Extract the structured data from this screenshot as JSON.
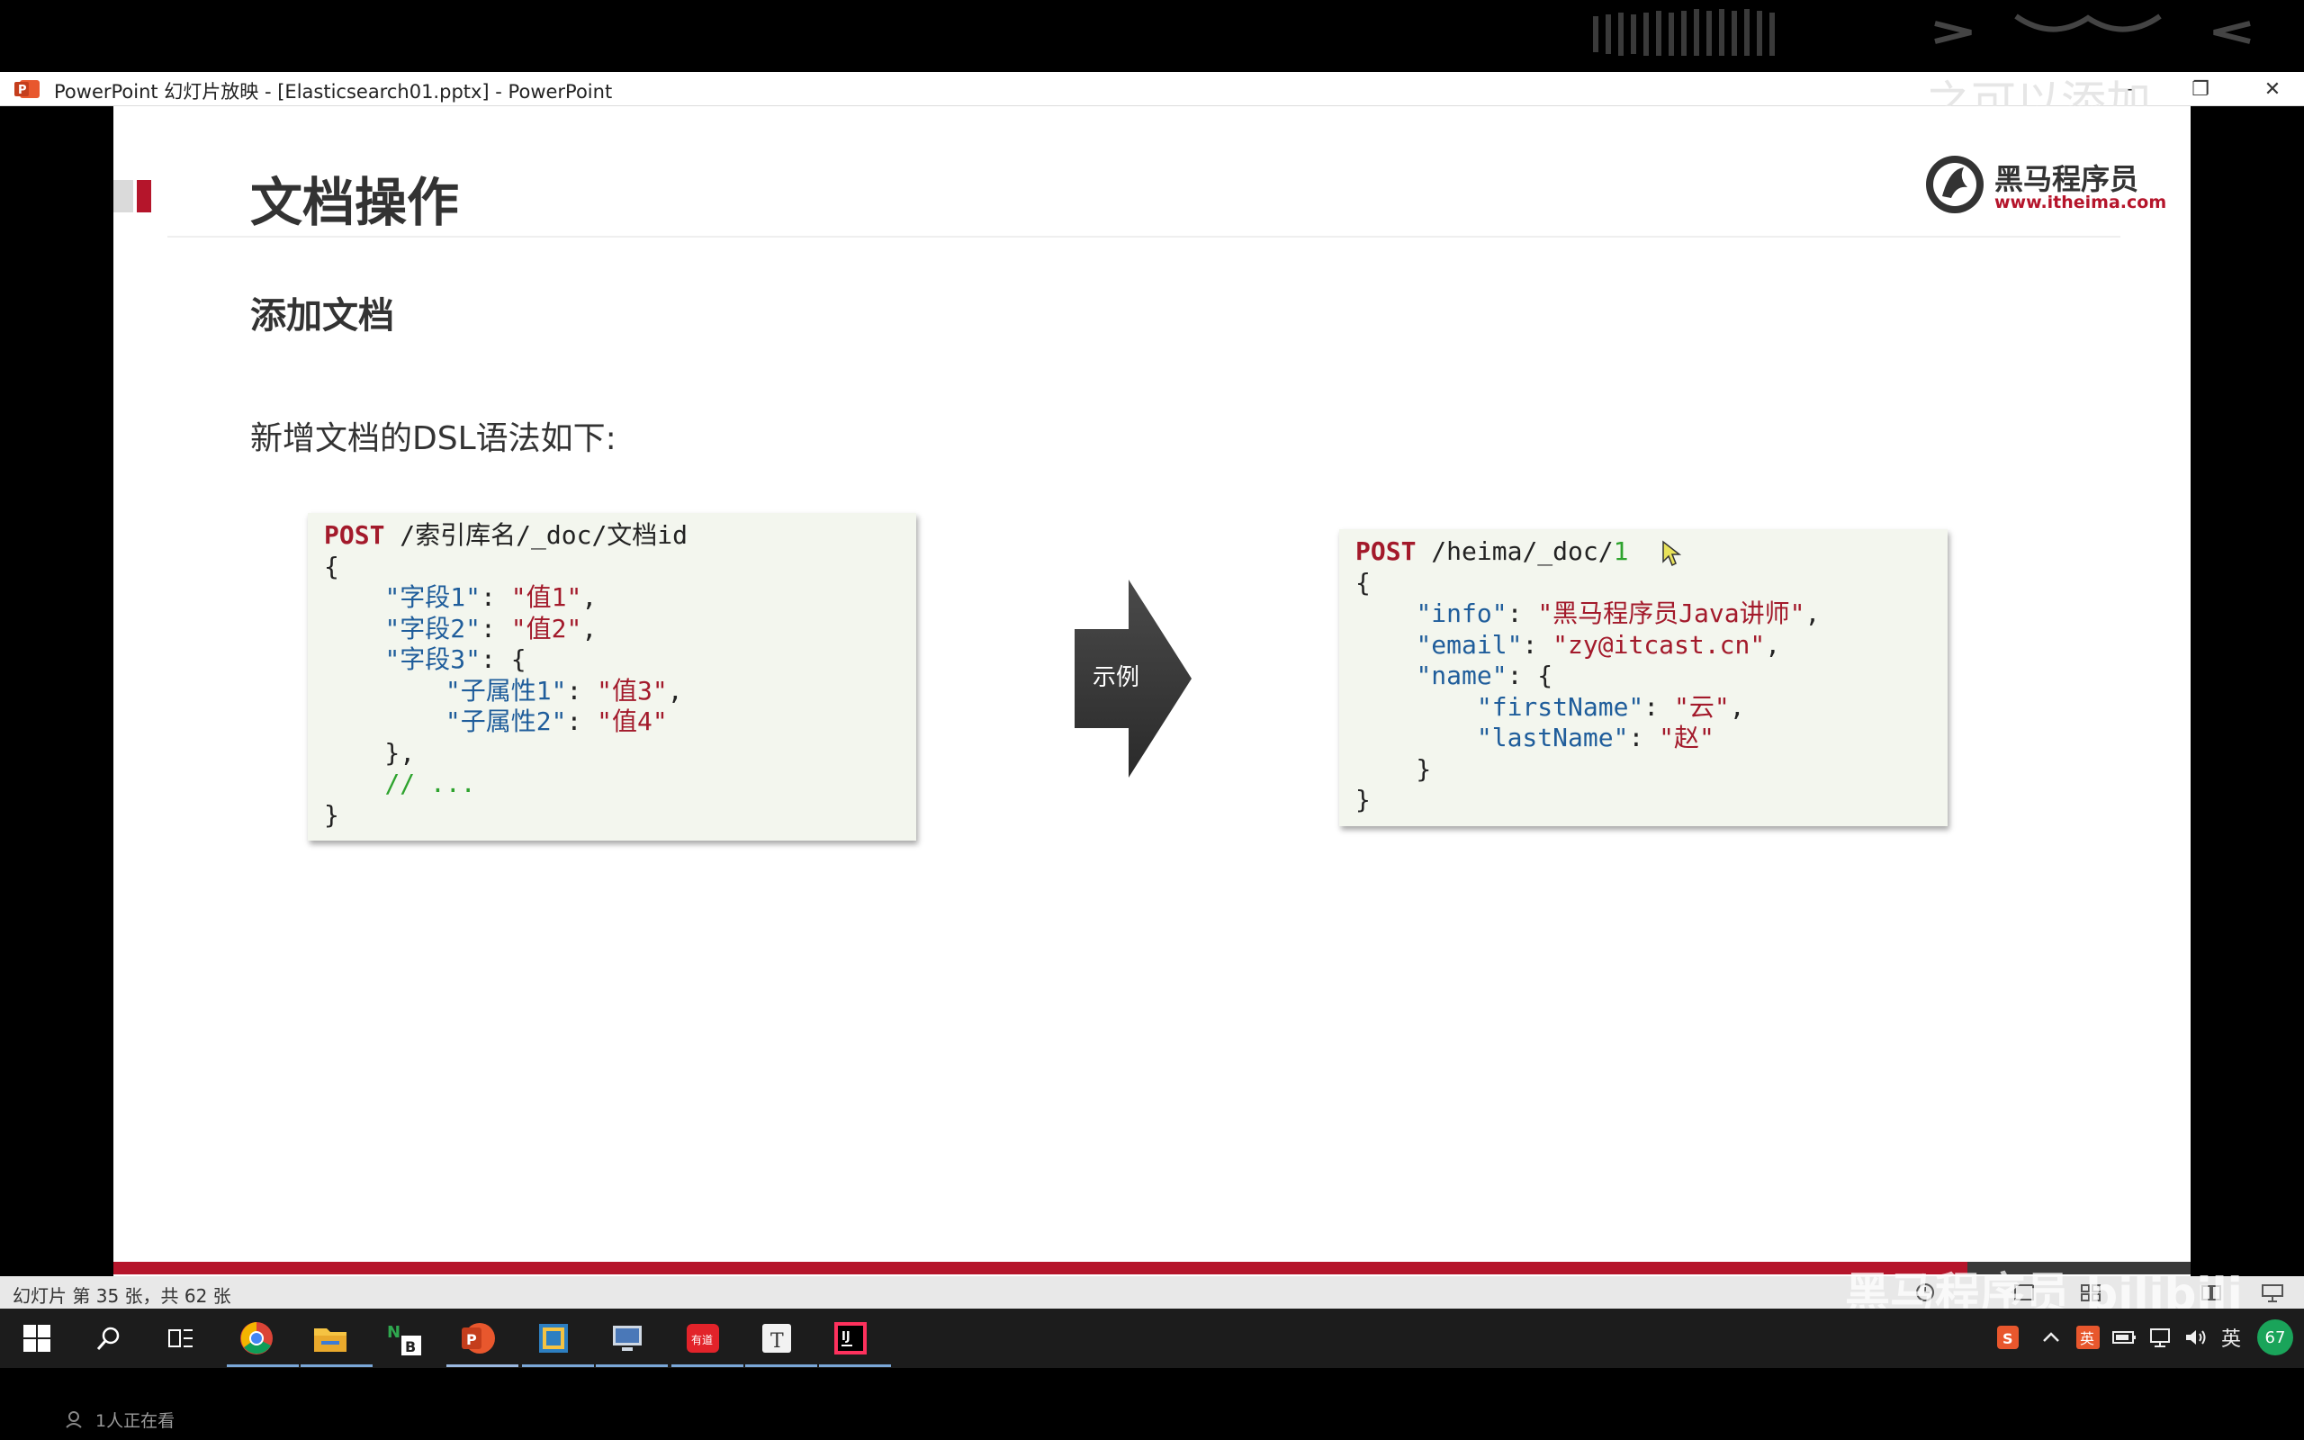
{
  "window": {
    "title": "PowerPoint 幻灯片放映 - [Elasticsearch01.pptx] - PowerPoint",
    "overlay_watermark": "之可以添加",
    "controls": {
      "minimize": "–",
      "restore": "❐",
      "close": "✕"
    }
  },
  "slide": {
    "title": "文档操作",
    "logo": {
      "name": "黑马程序员",
      "url": "www.itheima.com"
    },
    "section_title": "添加文档",
    "intro": "新增文档的DSL语法如下:",
    "arrow_label": "示例",
    "code_left": [
      [
        {
          "t": "POST",
          "c": "kw"
        },
        {
          "t": " /索引库名/_doc/文档id",
          "c": ""
        }
      ],
      [
        {
          "t": "{",
          "c": ""
        }
      ],
      [
        {
          "t": "    ",
          "c": ""
        },
        {
          "t": "\"字段1\"",
          "c": "key"
        },
        {
          "t": ": ",
          "c": ""
        },
        {
          "t": "\"值1\"",
          "c": "str"
        },
        {
          "t": ",",
          "c": ""
        }
      ],
      [
        {
          "t": "    ",
          "c": ""
        },
        {
          "t": "\"字段2\"",
          "c": "key"
        },
        {
          "t": ": ",
          "c": ""
        },
        {
          "t": "\"值2\"",
          "c": "str"
        },
        {
          "t": ",",
          "c": ""
        }
      ],
      [
        {
          "t": "    ",
          "c": ""
        },
        {
          "t": "\"字段3\"",
          "c": "key"
        },
        {
          "t": ": {",
          "c": ""
        }
      ],
      [
        {
          "t": "        ",
          "c": ""
        },
        {
          "t": "\"子属性1\"",
          "c": "key"
        },
        {
          "t": ": ",
          "c": ""
        },
        {
          "t": "\"值3\"",
          "c": "str"
        },
        {
          "t": ",",
          "c": ""
        }
      ],
      [
        {
          "t": "        ",
          "c": ""
        },
        {
          "t": "\"子属性2\"",
          "c": "key"
        },
        {
          "t": ": ",
          "c": ""
        },
        {
          "t": "\"值4\"",
          "c": "str"
        }
      ],
      [
        {
          "t": "    },",
          "c": ""
        }
      ],
      [
        {
          "t": "    ",
          "c": ""
        },
        {
          "t": "// ...",
          "c": "cmt"
        }
      ],
      [
        {
          "t": "}",
          "c": ""
        }
      ]
    ],
    "code_right": [
      [
        {
          "t": "POST",
          "c": "kw"
        },
        {
          "t": " /heima/_doc/",
          "c": ""
        },
        {
          "t": "1",
          "c": "num"
        }
      ],
      [
        {
          "t": "{",
          "c": ""
        }
      ],
      [
        {
          "t": "    ",
          "c": ""
        },
        {
          "t": "\"info\"",
          "c": "key"
        },
        {
          "t": ": ",
          "c": ""
        },
        {
          "t": "\"黑马程序员Java讲师\"",
          "c": "str"
        },
        {
          "t": ",",
          "c": ""
        }
      ],
      [
        {
          "t": "    ",
          "c": ""
        },
        {
          "t": "\"email\"",
          "c": "key"
        },
        {
          "t": ": ",
          "c": ""
        },
        {
          "t": "\"zy@itcast.cn\"",
          "c": "str"
        },
        {
          "t": ",",
          "c": ""
        }
      ],
      [
        {
          "t": "    ",
          "c": ""
        },
        {
          "t": "\"name\"",
          "c": "key"
        },
        {
          "t": ": {",
          "c": ""
        }
      ],
      [
        {
          "t": "        ",
          "c": ""
        },
        {
          "t": "\"firstName\"",
          "c": "key"
        },
        {
          "t": ": ",
          "c": ""
        },
        {
          "t": "\"云\"",
          "c": "str"
        },
        {
          "t": ",",
          "c": ""
        }
      ],
      [
        {
          "t": "        ",
          "c": ""
        },
        {
          "t": "\"lastName\"",
          "c": "key"
        },
        {
          "t": ": ",
          "c": ""
        },
        {
          "t": "\"赵\"",
          "c": "str"
        }
      ],
      [
        {
          "t": "    }",
          "c": ""
        }
      ],
      [
        {
          "t": "}",
          "c": ""
        }
      ]
    ]
  },
  "statusbar": {
    "slide_counter": "幻灯片 第 35 张，共 62 张",
    "watermark": "黑马程序员 bilibili"
  },
  "taskbar": {
    "apps": [
      "windows-start",
      "search",
      "task-view",
      "chrome",
      "file-explorer",
      "notebook",
      "powerpoint",
      "virtualbox",
      "remote-desktop",
      "youdao",
      "typora",
      "intellij"
    ],
    "tray_ime": "英",
    "tray_badge": "67"
  },
  "viewers": "1人正在看",
  "colors": {
    "accent_red": "#b5152b",
    "code_bg": "#f3f6ee",
    "key_blue": "#1f5d9b",
    "comment_green": "#2ea32e"
  }
}
